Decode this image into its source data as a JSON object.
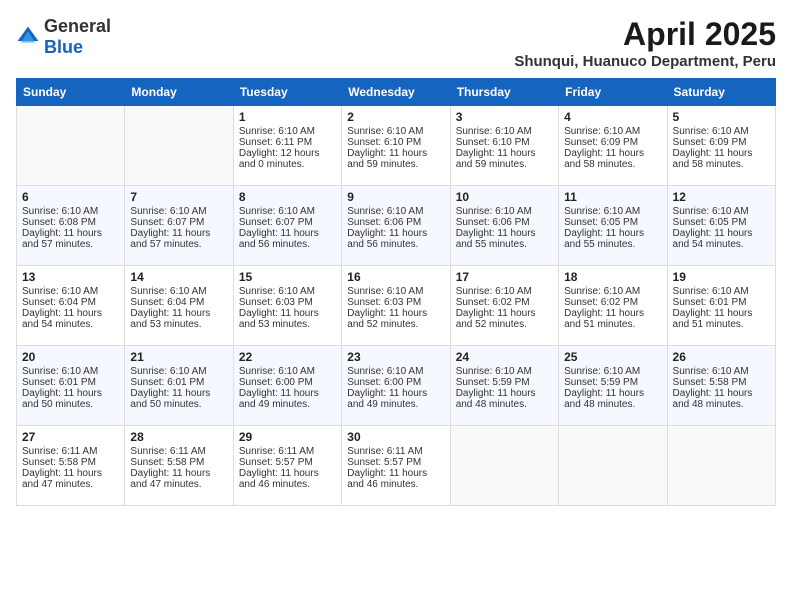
{
  "logo": {
    "general": "General",
    "blue": "Blue"
  },
  "title": "April 2025",
  "subtitle": "Shunqui, Huanuco Department, Peru",
  "days_header": [
    "Sunday",
    "Monday",
    "Tuesday",
    "Wednesday",
    "Thursday",
    "Friday",
    "Saturday"
  ],
  "weeks": [
    [
      {
        "day": "",
        "sunrise": "",
        "sunset": "",
        "daylight": ""
      },
      {
        "day": "",
        "sunrise": "",
        "sunset": "",
        "daylight": ""
      },
      {
        "day": "1",
        "sunrise": "Sunrise: 6:10 AM",
        "sunset": "Sunset: 6:11 PM",
        "daylight": "Daylight: 12 hours and 0 minutes."
      },
      {
        "day": "2",
        "sunrise": "Sunrise: 6:10 AM",
        "sunset": "Sunset: 6:10 PM",
        "daylight": "Daylight: 11 hours and 59 minutes."
      },
      {
        "day": "3",
        "sunrise": "Sunrise: 6:10 AM",
        "sunset": "Sunset: 6:10 PM",
        "daylight": "Daylight: 11 hours and 59 minutes."
      },
      {
        "day": "4",
        "sunrise": "Sunrise: 6:10 AM",
        "sunset": "Sunset: 6:09 PM",
        "daylight": "Daylight: 11 hours and 58 minutes."
      },
      {
        "day": "5",
        "sunrise": "Sunrise: 6:10 AM",
        "sunset": "Sunset: 6:09 PM",
        "daylight": "Daylight: 11 hours and 58 minutes."
      }
    ],
    [
      {
        "day": "6",
        "sunrise": "Sunrise: 6:10 AM",
        "sunset": "Sunset: 6:08 PM",
        "daylight": "Daylight: 11 hours and 57 minutes."
      },
      {
        "day": "7",
        "sunrise": "Sunrise: 6:10 AM",
        "sunset": "Sunset: 6:07 PM",
        "daylight": "Daylight: 11 hours and 57 minutes."
      },
      {
        "day": "8",
        "sunrise": "Sunrise: 6:10 AM",
        "sunset": "Sunset: 6:07 PM",
        "daylight": "Daylight: 11 hours and 56 minutes."
      },
      {
        "day": "9",
        "sunrise": "Sunrise: 6:10 AM",
        "sunset": "Sunset: 6:06 PM",
        "daylight": "Daylight: 11 hours and 56 minutes."
      },
      {
        "day": "10",
        "sunrise": "Sunrise: 6:10 AM",
        "sunset": "Sunset: 6:06 PM",
        "daylight": "Daylight: 11 hours and 55 minutes."
      },
      {
        "day": "11",
        "sunrise": "Sunrise: 6:10 AM",
        "sunset": "Sunset: 6:05 PM",
        "daylight": "Daylight: 11 hours and 55 minutes."
      },
      {
        "day": "12",
        "sunrise": "Sunrise: 6:10 AM",
        "sunset": "Sunset: 6:05 PM",
        "daylight": "Daylight: 11 hours and 54 minutes."
      }
    ],
    [
      {
        "day": "13",
        "sunrise": "Sunrise: 6:10 AM",
        "sunset": "Sunset: 6:04 PM",
        "daylight": "Daylight: 11 hours and 54 minutes."
      },
      {
        "day": "14",
        "sunrise": "Sunrise: 6:10 AM",
        "sunset": "Sunset: 6:04 PM",
        "daylight": "Daylight: 11 hours and 53 minutes."
      },
      {
        "day": "15",
        "sunrise": "Sunrise: 6:10 AM",
        "sunset": "Sunset: 6:03 PM",
        "daylight": "Daylight: 11 hours and 53 minutes."
      },
      {
        "day": "16",
        "sunrise": "Sunrise: 6:10 AM",
        "sunset": "Sunset: 6:03 PM",
        "daylight": "Daylight: 11 hours and 52 minutes."
      },
      {
        "day": "17",
        "sunrise": "Sunrise: 6:10 AM",
        "sunset": "Sunset: 6:02 PM",
        "daylight": "Daylight: 11 hours and 52 minutes."
      },
      {
        "day": "18",
        "sunrise": "Sunrise: 6:10 AM",
        "sunset": "Sunset: 6:02 PM",
        "daylight": "Daylight: 11 hours and 51 minutes."
      },
      {
        "day": "19",
        "sunrise": "Sunrise: 6:10 AM",
        "sunset": "Sunset: 6:01 PM",
        "daylight": "Daylight: 11 hours and 51 minutes."
      }
    ],
    [
      {
        "day": "20",
        "sunrise": "Sunrise: 6:10 AM",
        "sunset": "Sunset: 6:01 PM",
        "daylight": "Daylight: 11 hours and 50 minutes."
      },
      {
        "day": "21",
        "sunrise": "Sunrise: 6:10 AM",
        "sunset": "Sunset: 6:01 PM",
        "daylight": "Daylight: 11 hours and 50 minutes."
      },
      {
        "day": "22",
        "sunrise": "Sunrise: 6:10 AM",
        "sunset": "Sunset: 6:00 PM",
        "daylight": "Daylight: 11 hours and 49 minutes."
      },
      {
        "day": "23",
        "sunrise": "Sunrise: 6:10 AM",
        "sunset": "Sunset: 6:00 PM",
        "daylight": "Daylight: 11 hours and 49 minutes."
      },
      {
        "day": "24",
        "sunrise": "Sunrise: 6:10 AM",
        "sunset": "Sunset: 5:59 PM",
        "daylight": "Daylight: 11 hours and 48 minutes."
      },
      {
        "day": "25",
        "sunrise": "Sunrise: 6:10 AM",
        "sunset": "Sunset: 5:59 PM",
        "daylight": "Daylight: 11 hours and 48 minutes."
      },
      {
        "day": "26",
        "sunrise": "Sunrise: 6:10 AM",
        "sunset": "Sunset: 5:58 PM",
        "daylight": "Daylight: 11 hours and 48 minutes."
      }
    ],
    [
      {
        "day": "27",
        "sunrise": "Sunrise: 6:11 AM",
        "sunset": "Sunset: 5:58 PM",
        "daylight": "Daylight: 11 hours and 47 minutes."
      },
      {
        "day": "28",
        "sunrise": "Sunrise: 6:11 AM",
        "sunset": "Sunset: 5:58 PM",
        "daylight": "Daylight: 11 hours and 47 minutes."
      },
      {
        "day": "29",
        "sunrise": "Sunrise: 6:11 AM",
        "sunset": "Sunset: 5:57 PM",
        "daylight": "Daylight: 11 hours and 46 minutes."
      },
      {
        "day": "30",
        "sunrise": "Sunrise: 6:11 AM",
        "sunset": "Sunset: 5:57 PM",
        "daylight": "Daylight: 11 hours and 46 minutes."
      },
      {
        "day": "",
        "sunrise": "",
        "sunset": "",
        "daylight": ""
      },
      {
        "day": "",
        "sunrise": "",
        "sunset": "",
        "daylight": ""
      },
      {
        "day": "",
        "sunrise": "",
        "sunset": "",
        "daylight": ""
      }
    ]
  ]
}
